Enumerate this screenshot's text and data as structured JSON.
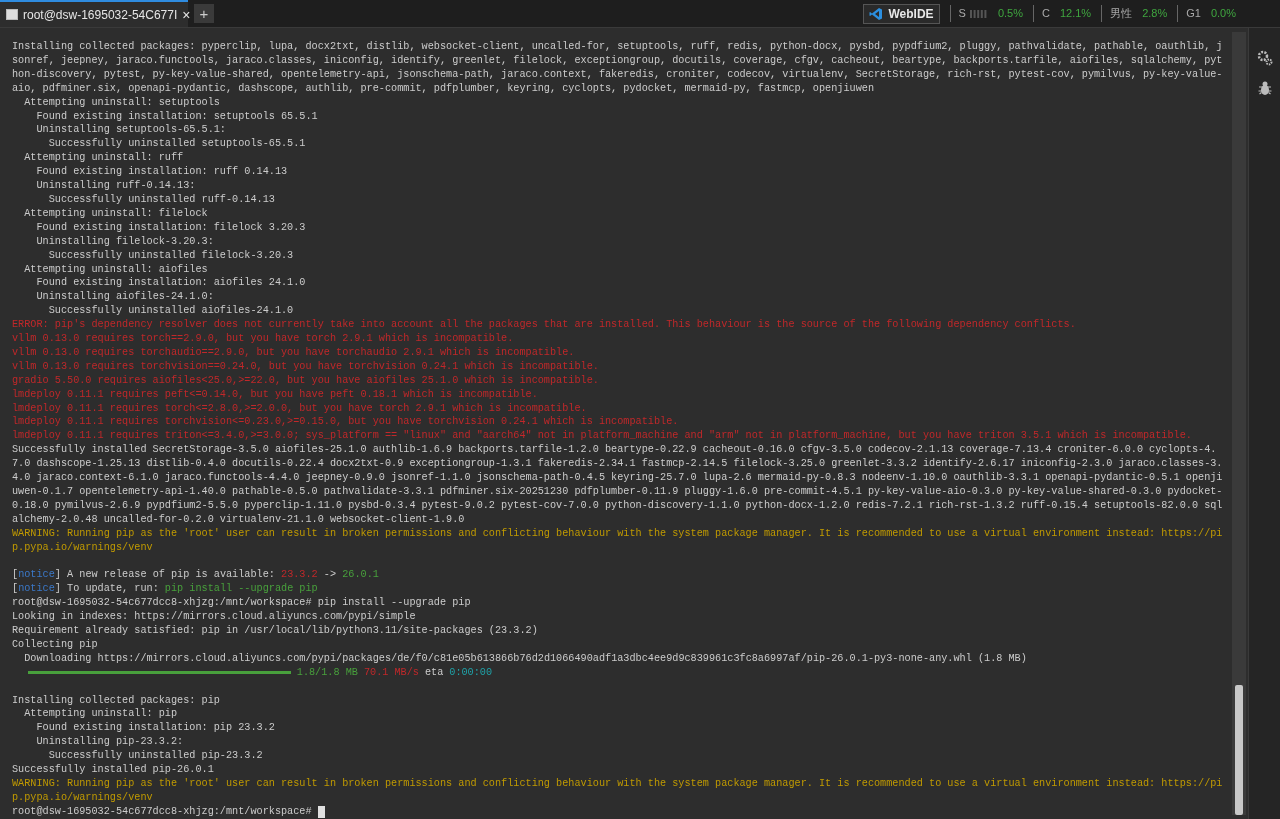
{
  "tabs": [
    {
      "label": "root@dsw-1695032-54C677I",
      "close": "×",
      "selected": true
    }
  ],
  "new_tab": "+",
  "status": {
    "badge": "WebIDE",
    "stats": [
      {
        "label": "S",
        "value": "0.5%",
        "kind": "meter"
      },
      {
        "label": "C",
        "value": "12.1%",
        "kind": "plain"
      },
      {
        "label": "男性",
        "value": "2.8%",
        "kind": "plain"
      },
      {
        "label": "G1",
        "value": "0.0%",
        "kind": "plain"
      }
    ]
  },
  "terminal": {
    "lines": [
      {
        "kind": "plain",
        "text": "Installing collected packages: pyperclip, lupa, docx2txt, distlib, websocket-client, uncalled-for, setuptools, ruff, redis, python-docx, pysbd, pypdfium2, pluggy, pathvalidate, pathable, oauthlib, jsonref, jeepney, jaraco.functools, jaraco.classes, iniconfig, identify, greenlet, filelock, exceptiongroup, docutils, coverage, cfgv, cacheout, beartype, backports.tarfile, aiofiles, sqlalchemy, python-discovery, pytest, py-key-value-shared, opentelemetry-api, jsonschema-path, jaraco.context, fakeredis, croniter, codecov, virtualenv, SecretStorage, rich-rst, pytest-cov, pymilvus, py-key-value-aio, pdfminer.six, openapi-pydantic, dashscope, authlib, pre-commit, pdfplumber, keyring, cyclopts, pydocket, mermaid-py, fastmcp, openjiuwen"
      },
      {
        "kind": "plain",
        "text": "  Attempting uninstall: setuptools"
      },
      {
        "kind": "plain",
        "text": "    Found existing installation: setuptools 65.5.1"
      },
      {
        "kind": "plain",
        "text": "    Uninstalling setuptools-65.5.1:"
      },
      {
        "kind": "plain",
        "text": "      Successfully uninstalled setuptools-65.5.1"
      },
      {
        "kind": "plain",
        "text": "  Attempting uninstall: ruff"
      },
      {
        "kind": "plain",
        "text": "    Found existing installation: ruff 0.14.13"
      },
      {
        "kind": "plain",
        "text": "    Uninstalling ruff-0.14.13:"
      },
      {
        "kind": "plain",
        "text": "      Successfully uninstalled ruff-0.14.13"
      },
      {
        "kind": "plain",
        "text": "  Attempting uninstall: filelock"
      },
      {
        "kind": "plain",
        "text": "    Found existing installation: filelock 3.20.3"
      },
      {
        "kind": "plain",
        "text": "    Uninstalling filelock-3.20.3:"
      },
      {
        "kind": "plain",
        "text": "      Successfully uninstalled filelock-3.20.3"
      },
      {
        "kind": "plain",
        "text": "  Attempting uninstall: aiofiles"
      },
      {
        "kind": "plain",
        "text": "    Found existing installation: aiofiles 24.1.0"
      },
      {
        "kind": "plain",
        "text": "    Uninstalling aiofiles-24.1.0:"
      },
      {
        "kind": "plain",
        "text": "      Successfully uninstalled aiofiles-24.1.0"
      },
      {
        "kind": "error",
        "text": "ERROR: pip's dependency resolver does not currently take into account all the packages that are installed. This behaviour is the source of the following dependency conflicts."
      },
      {
        "kind": "error",
        "text": "vllm 0.13.0 requires torch==2.9.0, but you have torch 2.9.1 which is incompatible."
      },
      {
        "kind": "error",
        "text": "vllm 0.13.0 requires torchaudio==2.9.0, but you have torchaudio 2.9.1 which is incompatible."
      },
      {
        "kind": "error",
        "text": "vllm 0.13.0 requires torchvision==0.24.0, but you have torchvision 0.24.1 which is incompatible."
      },
      {
        "kind": "error",
        "text": "gradio 5.50.0 requires aiofiles<25.0,>=22.0, but you have aiofiles 25.1.0 which is incompatible."
      },
      {
        "kind": "error",
        "text": "lmdeploy 0.11.1 requires peft<=0.14.0, but you have peft 0.18.1 which is incompatible."
      },
      {
        "kind": "error",
        "text": "lmdeploy 0.11.1 requires torch<=2.8.0,>=2.0.0, but you have torch 2.9.1 which is incompatible."
      },
      {
        "kind": "error",
        "text": "lmdeploy 0.11.1 requires torchvision<=0.23.0,>=0.15.0, but you have torchvision 0.24.1 which is incompatible."
      },
      {
        "kind": "error",
        "text": "lmdeploy 0.11.1 requires triton<=3.4.0,>=3.0.0; sys_platform == \"linux\" and \"aarch64\" not in platform_machine and \"arm\" not in platform_machine, but you have triton 3.5.1 which is incompatible."
      },
      {
        "kind": "plain",
        "text": "Successfully installed SecretStorage-3.5.0 aiofiles-25.1.0 authlib-1.6.9 backports.tarfile-1.2.0 beartype-0.22.9 cacheout-0.16.0 cfgv-3.5.0 codecov-2.1.13 coverage-7.13.4 croniter-6.0.0 cyclopts-4.7.0 dashscope-1.25.13 distlib-0.4.0 docutils-0.22.4 docx2txt-0.9 exceptiongroup-1.3.1 fakeredis-2.34.1 fastmcp-2.14.5 filelock-3.25.0 greenlet-3.3.2 identify-2.6.17 iniconfig-2.3.0 jaraco.classes-3.4.0 jaraco.context-6.1.0 jaraco.functools-4.4.0 jeepney-0.9.0 jsonref-1.1.0 jsonschema-path-0.4.5 keyring-25.7.0 lupa-2.6 mermaid-py-0.8.3 nodeenv-1.10.0 oauthlib-3.3.1 openapi-pydantic-0.5.1 openjiuwen-0.1.7 opentelemetry-api-1.40.0 pathable-0.5.0 pathvalidate-3.3.1 pdfminer.six-20251230 pdfplumber-0.11.9 pluggy-1.6.0 pre-commit-4.5.1 py-key-value-aio-0.3.0 py-key-value-shared-0.3.0 pydocket-0.18.0 pymilvus-2.6.9 pypdfium2-5.5.0 pyperclip-1.11.0 pysbd-0.3.4 pytest-9.0.2 pytest-cov-7.0.0 python-discovery-1.1.0 python-docx-1.2.0 redis-7.2.1 rich-rst-1.3.2 ruff-0.15.4 setuptools-82.0.0 sqlalchemy-2.0.48 uncalled-for-0.2.0 virtualenv-21.1.0 websocket-client-1.9.0"
      },
      {
        "kind": "warning",
        "text": "WARNING: Running pip as the 'root' user can result in broken permissions and conflicting behaviour with the system package manager. It is recommended to use a virtual environment instead: https://pip.pypa.io/warnings/venv"
      },
      {
        "kind": "blank"
      },
      {
        "kind": "mixed",
        "parts": [
          {
            "kind": "plain",
            "text": "["
          },
          {
            "kind": "tag",
            "text": "notice"
          },
          {
            "kind": "plain",
            "text": "] A new release of pip is available: "
          },
          {
            "kind": "old",
            "text": "23.3.2"
          },
          {
            "kind": "plain",
            "text": " -> "
          },
          {
            "kind": "new",
            "text": "26.0.1"
          }
        ]
      },
      {
        "kind": "mixed",
        "parts": [
          {
            "kind": "plain",
            "text": "["
          },
          {
            "kind": "tag",
            "text": "notice"
          },
          {
            "kind": "plain",
            "text": "] To update, run: "
          },
          {
            "kind": "new",
            "text": "pip install --upgrade pip"
          }
        ]
      },
      {
        "kind": "plain",
        "text": "root@dsw-1695032-54c677dcc8-xhjzg:/mnt/workspace# pip install --upgrade pip"
      },
      {
        "kind": "plain",
        "text": "Looking in indexes: https://mirrors.cloud.aliyuncs.com/pypi/simple"
      },
      {
        "kind": "plain",
        "text": "Requirement already satisfied: pip in /usr/local/lib/python3.11/site-packages (23.3.2)"
      },
      {
        "kind": "plain",
        "text": "Collecting pip"
      },
      {
        "kind": "plain",
        "text": "  Downloading https://mirrors.cloud.aliyuncs.com/pypi/packages/de/f0/c81e05b613866b76d2d1066490adf1a3dbc4ee9d9c839961c3fc8a6997af/pip-26.0.1-py3-none-any.whl (1.8 MB)"
      },
      {
        "kind": "progress",
        "level": 1,
        "parts": [
          {
            "kind": "new",
            "text": "1.8/1.8 MB"
          },
          {
            "kind": "old",
            "text": "70.1 MB/s"
          },
          {
            "kind": "plain",
            "text": "eta"
          },
          {
            "kind": "eta",
            "text": "0:00:00"
          }
        ]
      },
      {
        "kind": "blank"
      },
      {
        "kind": "plain",
        "text": "Installing collected packages: pip"
      },
      {
        "kind": "plain",
        "text": "  Attempting uninstall: pip"
      },
      {
        "kind": "plain",
        "text": "    Found existing installation: pip 23.3.2"
      },
      {
        "kind": "plain",
        "text": "    Uninstalling pip-23.3.2:"
      },
      {
        "kind": "plain",
        "text": "      Successfully uninstalled pip-23.3.2"
      },
      {
        "kind": "plain",
        "text": "Successfully installed pip-26.0.1"
      },
      {
        "kind": "warning",
        "text": "WARNING: Running pip as the 'root' user can result in broken permissions and conflicting behaviour with the system package manager. It is recommended to use a virtual environment instead: https://pip.pypa.io/warnings/venv"
      },
      {
        "kind": "prompt",
        "text": "root@dsw-1695032-54c677dcc8-xhjzg:/mnt/workspace#"
      }
    ]
  }
}
